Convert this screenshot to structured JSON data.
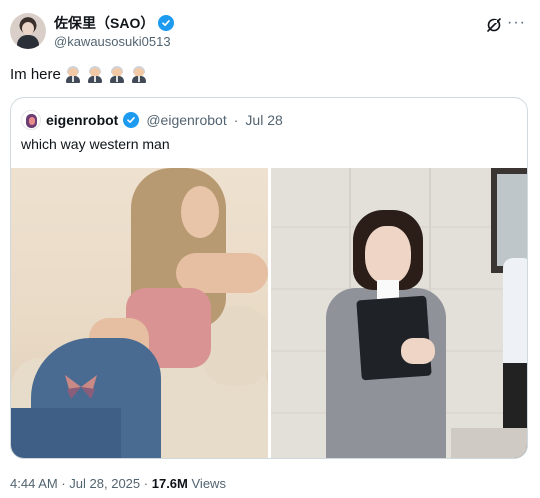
{
  "author": {
    "display_name": "佐保里（SAO）",
    "handle": "@kawausosuki0513",
    "avatar_icon": "user-avatar",
    "verified_icon": "verified-badge-icon"
  },
  "actions": {
    "grok_icon": "grok-icon",
    "more_icon": "more-options-icon",
    "more_glyph": "···"
  },
  "tweet": {
    "text": "Im here",
    "emoji_icon": "old-man-office-worker-emoji",
    "emoji_count": 4
  },
  "quote": {
    "display_name": "eigenrobot",
    "handle": "@eigenrobot",
    "separator": "·",
    "date": "Jul 28",
    "text": "which way western man",
    "images": [
      "woman-in-pink-top-and-jeans-photo",
      "woman-in-gray-suit-holding-folder-photo"
    ]
  },
  "footer": {
    "time": "4:44 AM",
    "separator": "·",
    "date": "Jul 28, 2025",
    "views_count": "17.6M",
    "views_label": "Views"
  },
  "colors": {
    "verified": "#1d9bf0",
    "secondary_text": "#536471",
    "primary_text": "#0f1419",
    "border": "#cfd9de"
  }
}
